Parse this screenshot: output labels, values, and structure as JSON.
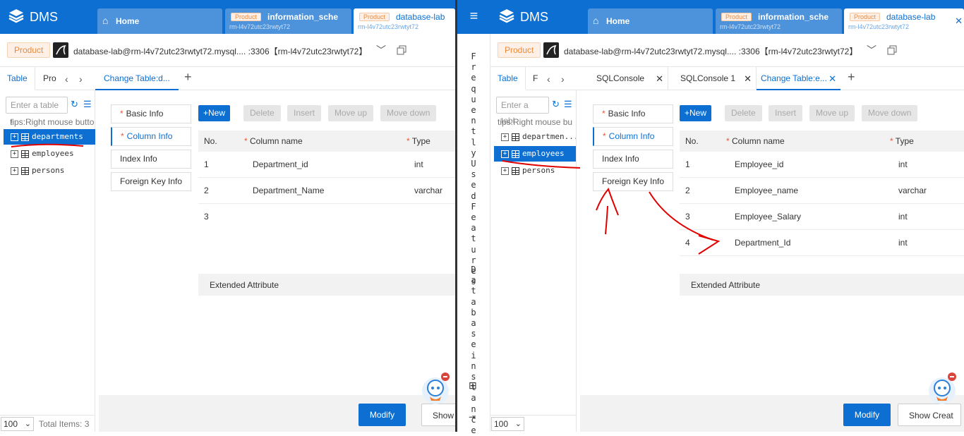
{
  "app": {
    "name": "DMS"
  },
  "colors": {
    "primary": "#0c6fd1",
    "product_badge": "#e98b3d",
    "annotation": "#e00000"
  },
  "icons": [
    "dms-logo-icon",
    "home-icon",
    "mysql-icon",
    "chevron-down-icon",
    "copy-icon",
    "chevron-left-icon",
    "chevron-right-icon",
    "refresh-icon",
    "list-icon",
    "expand-icon",
    "table-icon",
    "close-icon",
    "add-icon",
    "menu-icon",
    "grid-icon",
    "assistant-icon"
  ],
  "left": {
    "tabs": {
      "home": "Home",
      "t1": {
        "badge": "Product",
        "name": "information_sche",
        "sub": "rm-l4v72utc23rwtyt72"
      },
      "t2": {
        "badge": "Product",
        "name": "database-lab",
        "sub": "rm-l4v72utc23rwtyt72"
      }
    },
    "instance": {
      "badge": "Product",
      "conn": "database-lab@rm-l4v72utc23rwtyt72.mysql.... :3306【rm-l4v72utc23rwtyt72】"
    },
    "side_tabs": {
      "table": "Table",
      "pro": "Pro"
    },
    "search_placeholder": "Enter a table r",
    "tips": "tips:Right mouse butto",
    "tree": [
      "departments",
      "employees",
      "persons"
    ],
    "footer": {
      "page_size": "100",
      "total": "Total Items: 3"
    },
    "work_tabs": {
      "change": "Change Table:d..."
    },
    "menu": {
      "basic": "Basic Info",
      "column": "Column Info",
      "index": "Index Info",
      "fk": "Foreign Key Info"
    },
    "toolbar": {
      "new": "New",
      "delete": "Delete",
      "insert": "Insert",
      "move_up": "Move up",
      "move_down": "Move down"
    },
    "table": {
      "headers": {
        "no": "No.",
        "colname": "Column name",
        "type": "Type"
      },
      "rows": [
        {
          "no": "1",
          "name": "Department_id",
          "type": "int"
        },
        {
          "no": "2",
          "name": "Department_Name",
          "type": "varchar"
        },
        {
          "no": "3",
          "name": "",
          "type": ""
        }
      ]
    },
    "ext_attr": "Extended Attribute",
    "modify": "Modify",
    "show": "Show"
  },
  "strip": {
    "label1": "Frequently Used Features",
    "label2": "Database instance"
  },
  "right": {
    "tabs": {
      "home": "Home",
      "t1": {
        "badge": "Product",
        "name": "information_sche",
        "sub": "rm-l4v72utc23rwtyt72"
      },
      "t2": {
        "badge": "Product",
        "name": "database-lab",
        "sub": "rm-l4v72utc23rwtyt72"
      }
    },
    "instance": {
      "badge": "Product",
      "conn": "database-lab@rm-l4v72utc23rwtyt72.mysql.... :3306【rm-l4v72utc23rwtyt72】"
    },
    "side_tabs": {
      "table": "Table",
      "f": "F"
    },
    "search_placeholder": "Enter a tabl",
    "tips": "tips:Right mouse bu",
    "tree": [
      "departmen...",
      "employees",
      "persons"
    ],
    "footer": {
      "page_size": "100"
    },
    "work_tabs": {
      "sql1": "SQLConsole",
      "sql2": "SQLConsole 1",
      "change": "Change Table:e..."
    },
    "menu": {
      "basic": "Basic Info",
      "column": "Column Info",
      "index": "Index Info",
      "fk": "Foreign Key Info"
    },
    "toolbar": {
      "new": "New",
      "delete": "Delete",
      "insert": "Insert",
      "move_up": "Move up",
      "move_down": "Move down"
    },
    "table": {
      "headers": {
        "no": "No.",
        "colname": "Column name",
        "type": "Type"
      },
      "rows": [
        {
          "no": "1",
          "name": "Employee_id",
          "type": "int"
        },
        {
          "no": "2",
          "name": "Employee_name",
          "type": "varchar"
        },
        {
          "no": "3",
          "name": "Employee_Salary",
          "type": "int"
        },
        {
          "no": "4",
          "name": "Department_Id",
          "type": "int"
        }
      ]
    },
    "ext_attr": "Extended Attribute",
    "modify": "Modify",
    "show": "Show Creat"
  }
}
